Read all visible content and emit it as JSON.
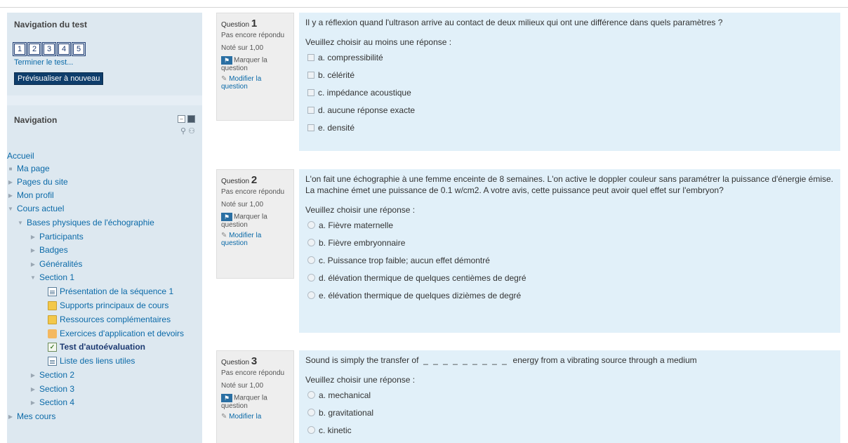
{
  "quiz_nav": {
    "title": "Navigation du test",
    "buttons": [
      "1",
      "2",
      "3",
      "4",
      "5"
    ],
    "finish_link": "Terminer le test...",
    "restart_button": "Prévisualiser à nouveau"
  },
  "nav_block": {
    "title": "Navigation",
    "items": [
      "Accueil",
      "Ma page",
      "Pages du site",
      "Mon profil",
      "Cours actuel",
      "Bases physiques de l'échographie",
      "Participants",
      "Badges",
      "Généralités",
      "Section 1",
      "Présentation de la séquence 1",
      "Supports principaux de cours",
      "Ressources complémentaires",
      "Exercices d'application et devoirs",
      "Test d'autoévaluation",
      "Liste des liens utiles",
      "Section 2",
      "Section 3",
      "Section 4",
      "Mes cours"
    ]
  },
  "questions": [
    {
      "label": "Question",
      "number": "1",
      "state": "Pas encore répondu",
      "grade": "Noté sur 1,00",
      "flag": "Marquer la question",
      "edit": "Modifier la question",
      "text": "Il y a réflexion quand l'ultrason arrive au contact de deux milieux qui ont une différence dans quels paramètres ?",
      "prompt": "Veuillez choisir au moins une réponse :",
      "answers": [
        "a. compressibilité",
        "b. célérité",
        "c. impédance acoustique",
        "d. aucune réponse exacte",
        "e. densité"
      ]
    },
    {
      "label": "Question",
      "number": "2",
      "state": "Pas encore répondu",
      "grade": "Noté sur 1,00",
      "flag": "Marquer la question",
      "edit": "Modifier la question",
      "text": "L'on fait une échographie à une femme enceinte de 8 semaines. L'on active le doppler couleur sans paramétrer la puissance d'énergie émise. La machine émet une puissance de 0.1 w/cm2. A votre avis, cette puissance peut avoir quel effet sur l'embryon?",
      "prompt": "Veuillez choisir une réponse :",
      "answers": [
        "a. Fièvre maternelle",
        "b. Fièvre embryonnaire",
        "c. Puissance trop faible; aucun effet démontré",
        "d. élévation thermique de quelques centièmes de degré",
        "e. élévation thermique de quelques dizièmes de degré"
      ]
    },
    {
      "label": "Question",
      "number": "3",
      "state": "Pas encore répondu",
      "grade": "Noté sur 1,00",
      "flag": "Marquer la question",
      "edit": "Modifier la",
      "text_before": "Sound is simply the transfer of",
      "blank": "_ _ _ _ _ _ _ _ _",
      "text_after": "energy from a vibrating source through a medium",
      "prompt": "Veuillez choisir une réponse :",
      "answers": [
        "a. mechanical",
        "b. gravitational",
        "c. kinetic"
      ]
    }
  ]
}
